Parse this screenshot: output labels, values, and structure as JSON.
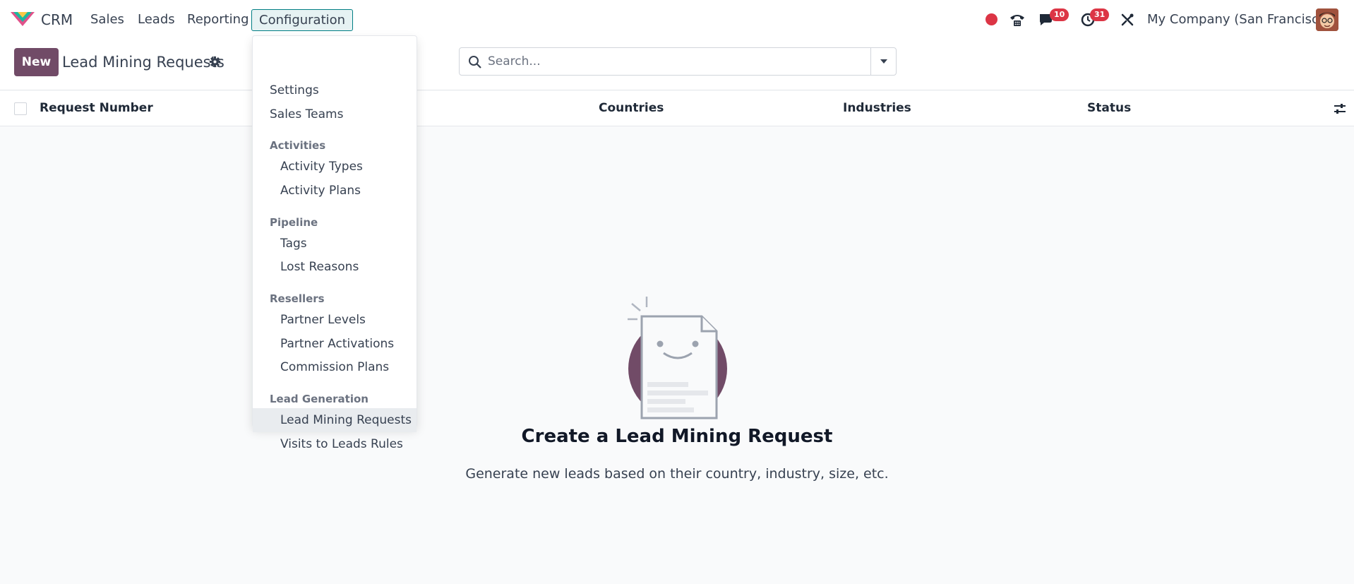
{
  "navbar": {
    "app_name": "CRM",
    "menu": [
      "Sales",
      "Leads",
      "Reporting"
    ],
    "active_menu": "Configuration",
    "chat_badge": "10",
    "activity_badge": "31",
    "company": "My Company (San Francisco)"
  },
  "control_panel": {
    "new_button": "New",
    "title": "Lead Mining Requests",
    "search_placeholder": "Search..."
  },
  "list": {
    "columns": [
      "Request Number",
      "Countries",
      "Industries",
      "Status"
    ]
  },
  "dropdown": {
    "items_top": [
      "Settings",
      "Sales Teams"
    ],
    "sections": [
      {
        "label": "Activities",
        "items": [
          "Activity Types",
          "Activity Plans"
        ]
      },
      {
        "label": "Pipeline",
        "items": [
          "Tags",
          "Lost Reasons"
        ]
      },
      {
        "label": "Resellers",
        "items": [
          "Partner Levels",
          "Partner Activations",
          "Commission Plans"
        ]
      },
      {
        "label": "Lead Generation",
        "items": [
          "Lead Mining Requests",
          "Visits to Leads Rules"
        ]
      }
    ],
    "highlighted": "Lead Mining Requests"
  },
  "empty_state": {
    "title": "Create a Lead Mining Request",
    "subtitle": "Generate new leads based on their country, industry, size, etc."
  },
  "colors": {
    "brand": "#714b67",
    "accent": "#017e84",
    "badge": "#dc3545"
  }
}
